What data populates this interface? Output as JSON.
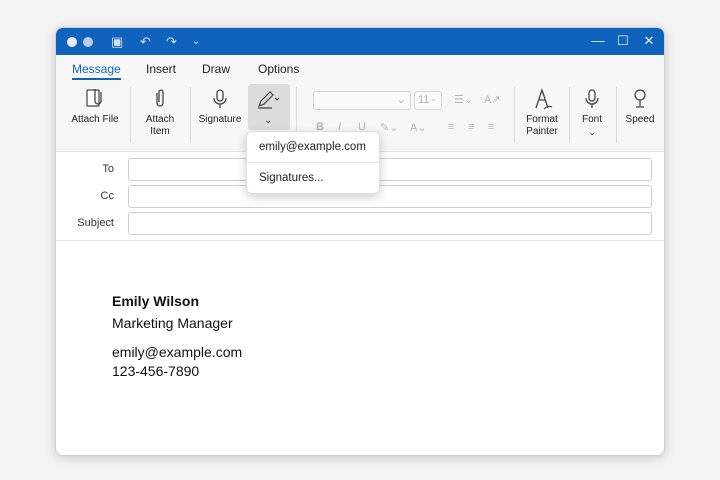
{
  "tabs": [
    "Message",
    "Insert",
    "Draw",
    "Options"
  ],
  "ribbon": {
    "attach_file": "Attach File",
    "attach_item_l1": "Attach",
    "attach_item_l2": "Item",
    "signature": "Signature",
    "font_size": "11",
    "format_painter_l1": "Format",
    "format_painter_l2": "Painter",
    "font": "Font",
    "speed": "Speed"
  },
  "dropdown": {
    "email": "emily@example.com",
    "signatures": "Signatures..."
  },
  "fields": {
    "to_label": "To",
    "cc_label": "Cc",
    "subject_label": "Subject"
  },
  "signature_block": {
    "name": "Emily Wilson",
    "title": "Marketing Manager",
    "email": "emily@example.com",
    "phone": "123-456-7890"
  },
  "colors": {
    "accent": "#0f63bd"
  }
}
